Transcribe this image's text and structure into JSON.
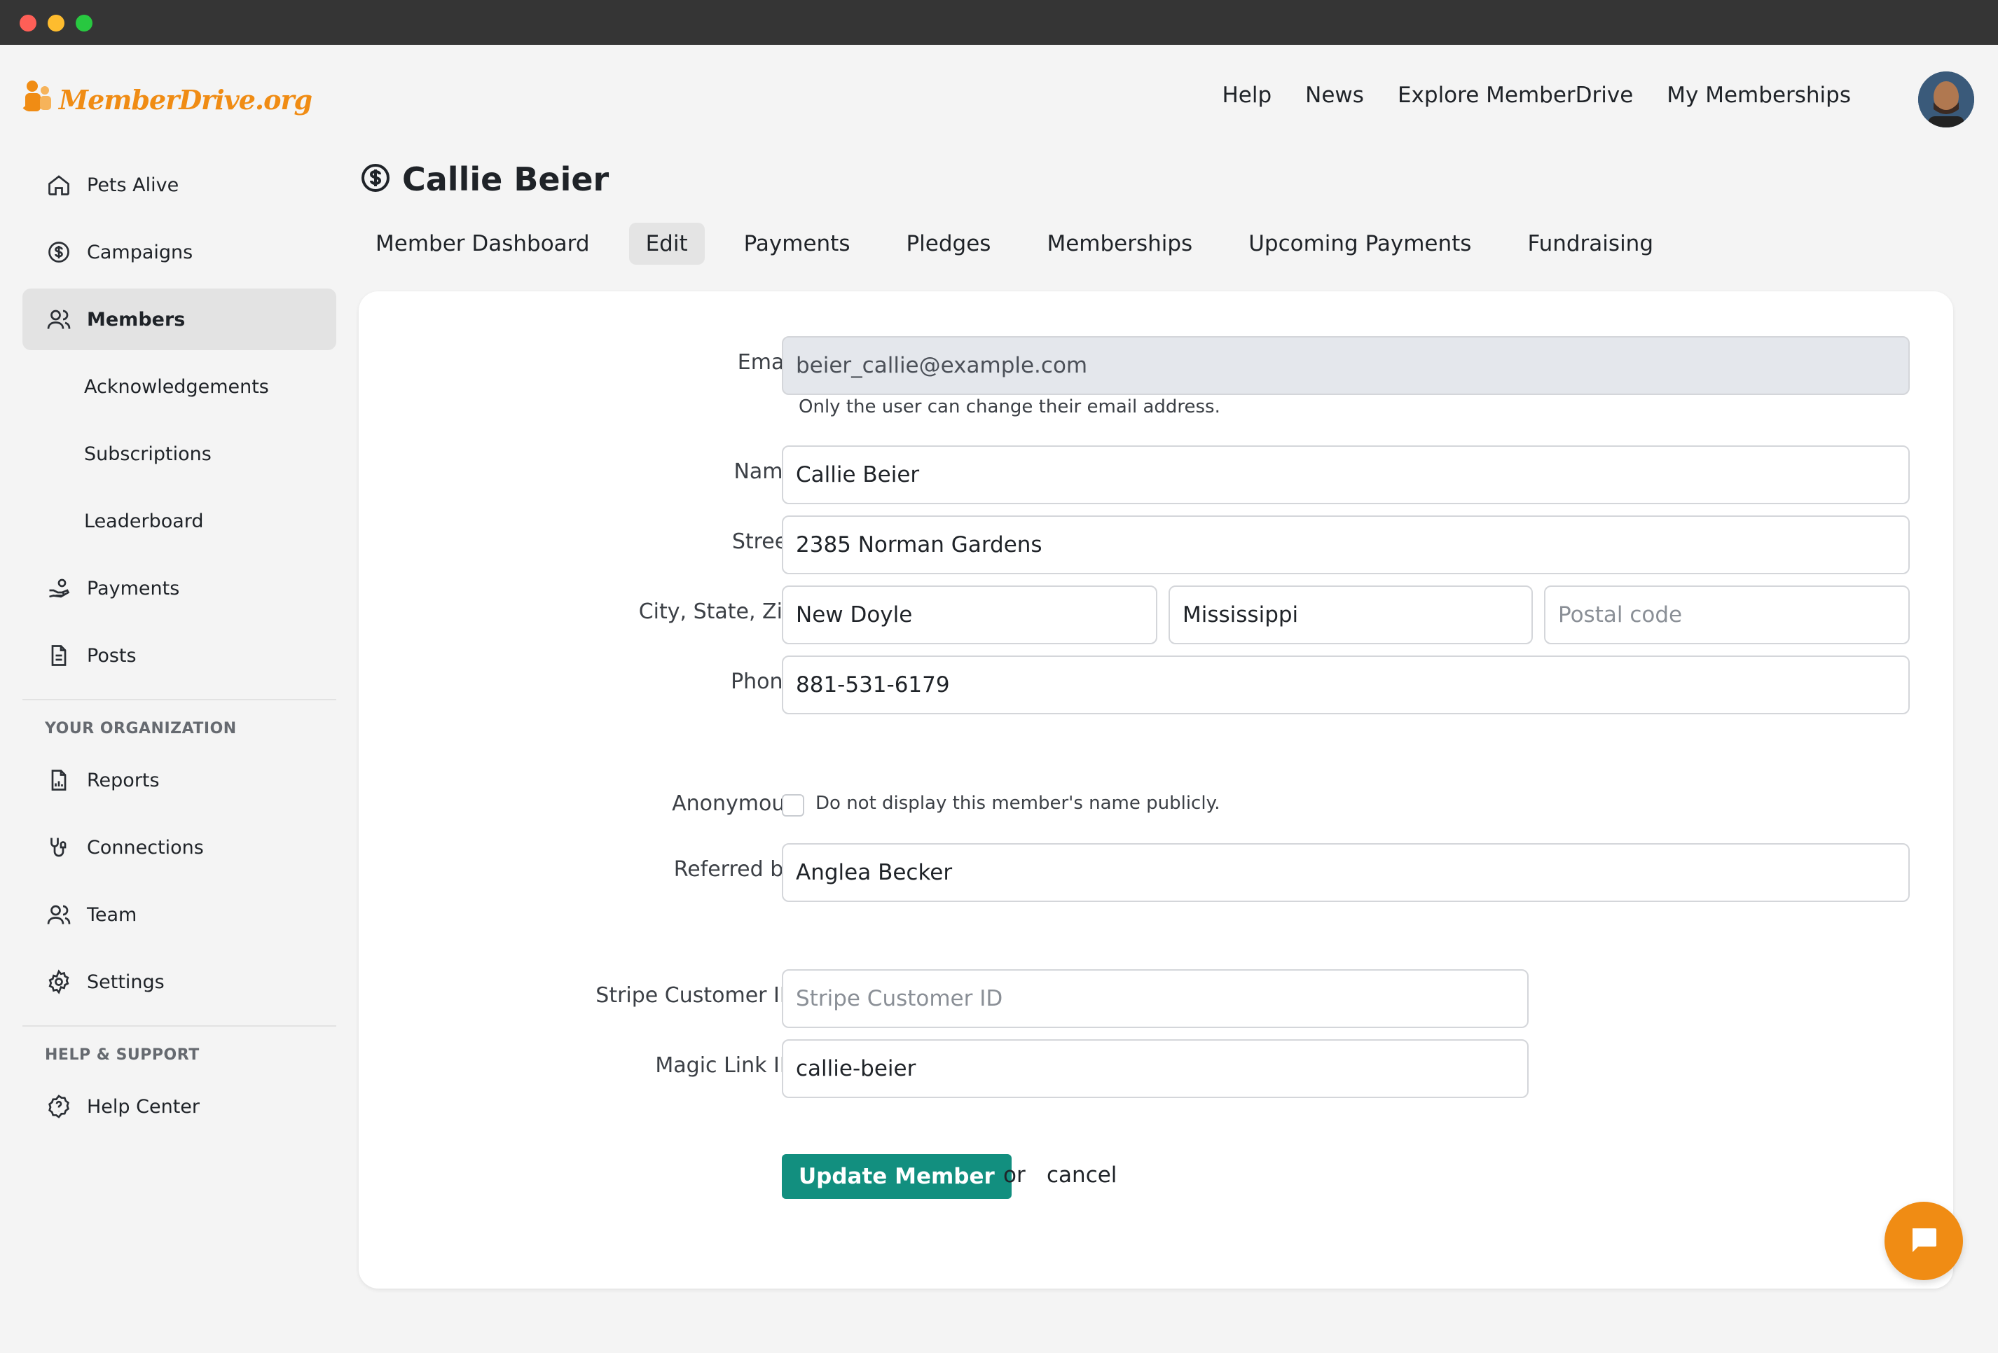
{
  "brand": {
    "name": "MemberDrive.org",
    "accent": "#f08c14",
    "primary_button": "#128f7f"
  },
  "topnav": {
    "items": [
      "Help",
      "News",
      "Explore MemberDrive",
      "My Memberships"
    ]
  },
  "sidebar": {
    "items": [
      {
        "label": "Pets Alive",
        "icon": "home-icon"
      },
      {
        "label": "Campaigns",
        "icon": "dollar-circle-icon"
      },
      {
        "label": "Members",
        "icon": "users-icon",
        "active": true
      },
      {
        "label": "Acknowledgements"
      },
      {
        "label": "Subscriptions"
      },
      {
        "label": "Leaderboard"
      },
      {
        "label": "Payments",
        "icon": "hand-coin-icon"
      },
      {
        "label": "Posts",
        "icon": "document-icon"
      }
    ],
    "org_heading": "YOUR ORGANIZATION",
    "org_items": [
      {
        "label": "Reports",
        "icon": "report-icon"
      },
      {
        "label": "Connections",
        "icon": "connection-icon"
      },
      {
        "label": "Team",
        "icon": "users-icon"
      },
      {
        "label": "Settings",
        "icon": "gear-icon"
      }
    ],
    "help_heading": "HELP & SUPPORT",
    "help_items": [
      {
        "label": "Help Center",
        "icon": "question-circle-icon"
      }
    ]
  },
  "page": {
    "title": "Callie Beier",
    "tabs": [
      "Member Dashboard",
      "Edit",
      "Payments",
      "Pledges",
      "Memberships",
      "Upcoming Payments",
      "Fundraising"
    ],
    "active_tab": "Edit"
  },
  "form": {
    "email_label": "Email",
    "email_value": "beier_callie@example.com",
    "email_hint": "Only the user can change their email address.",
    "name_label": "Name",
    "name_value": "Callie Beier",
    "street_label": "Street",
    "street_value": "2385 Norman Gardens",
    "city_label": "City, State, Zip",
    "city_value": "New Doyle",
    "state_value": "Mississippi",
    "zip_placeholder": "Postal code",
    "phone_label": "Phone",
    "phone_value": "881-531-6179",
    "anonymous_label": "Anonymous",
    "anonymous_hint": "Do not display this member's name publicly.",
    "anonymous_checked": false,
    "referred_label": "Referred by",
    "referred_value": "Anglea Becker",
    "stripe_label": "Stripe Customer ID",
    "stripe_placeholder": "Stripe Customer ID",
    "magic_label": "Magic Link ID",
    "magic_value": "callie-beier",
    "submit_label": "Update Member",
    "or_text": "or",
    "cancel_label": "cancel"
  }
}
